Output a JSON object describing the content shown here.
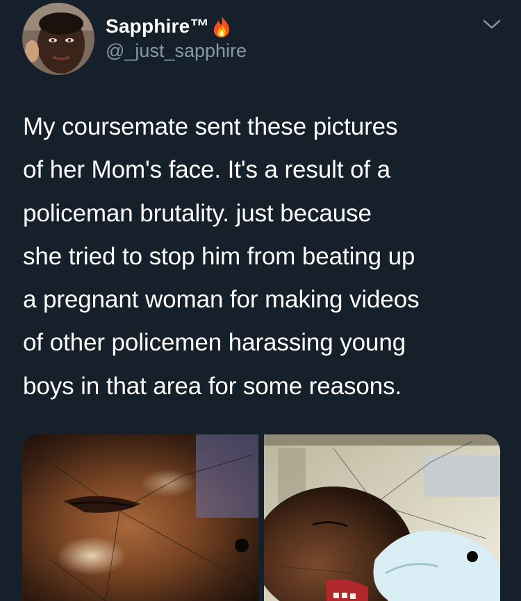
{
  "tweet": {
    "display_name": "Sapphire™",
    "handle": "@_just_sapphire",
    "text": "My coursemate sent these pictures\nof her Mom's face. It's a result of a\npoliceman brutality.  just because\nshe tried to stop him from beating up\na pregnant woman for making videos\nof other policemen harassing young\nboys in that area for some reasons.",
    "media_count": 2
  },
  "icons": {
    "name_emoji": "fire-icon",
    "menu": "chevron-down-icon"
  },
  "colors": {
    "background": "#15202b",
    "primary_text": "#ffffff",
    "secondary_text": "#8899a6"
  }
}
